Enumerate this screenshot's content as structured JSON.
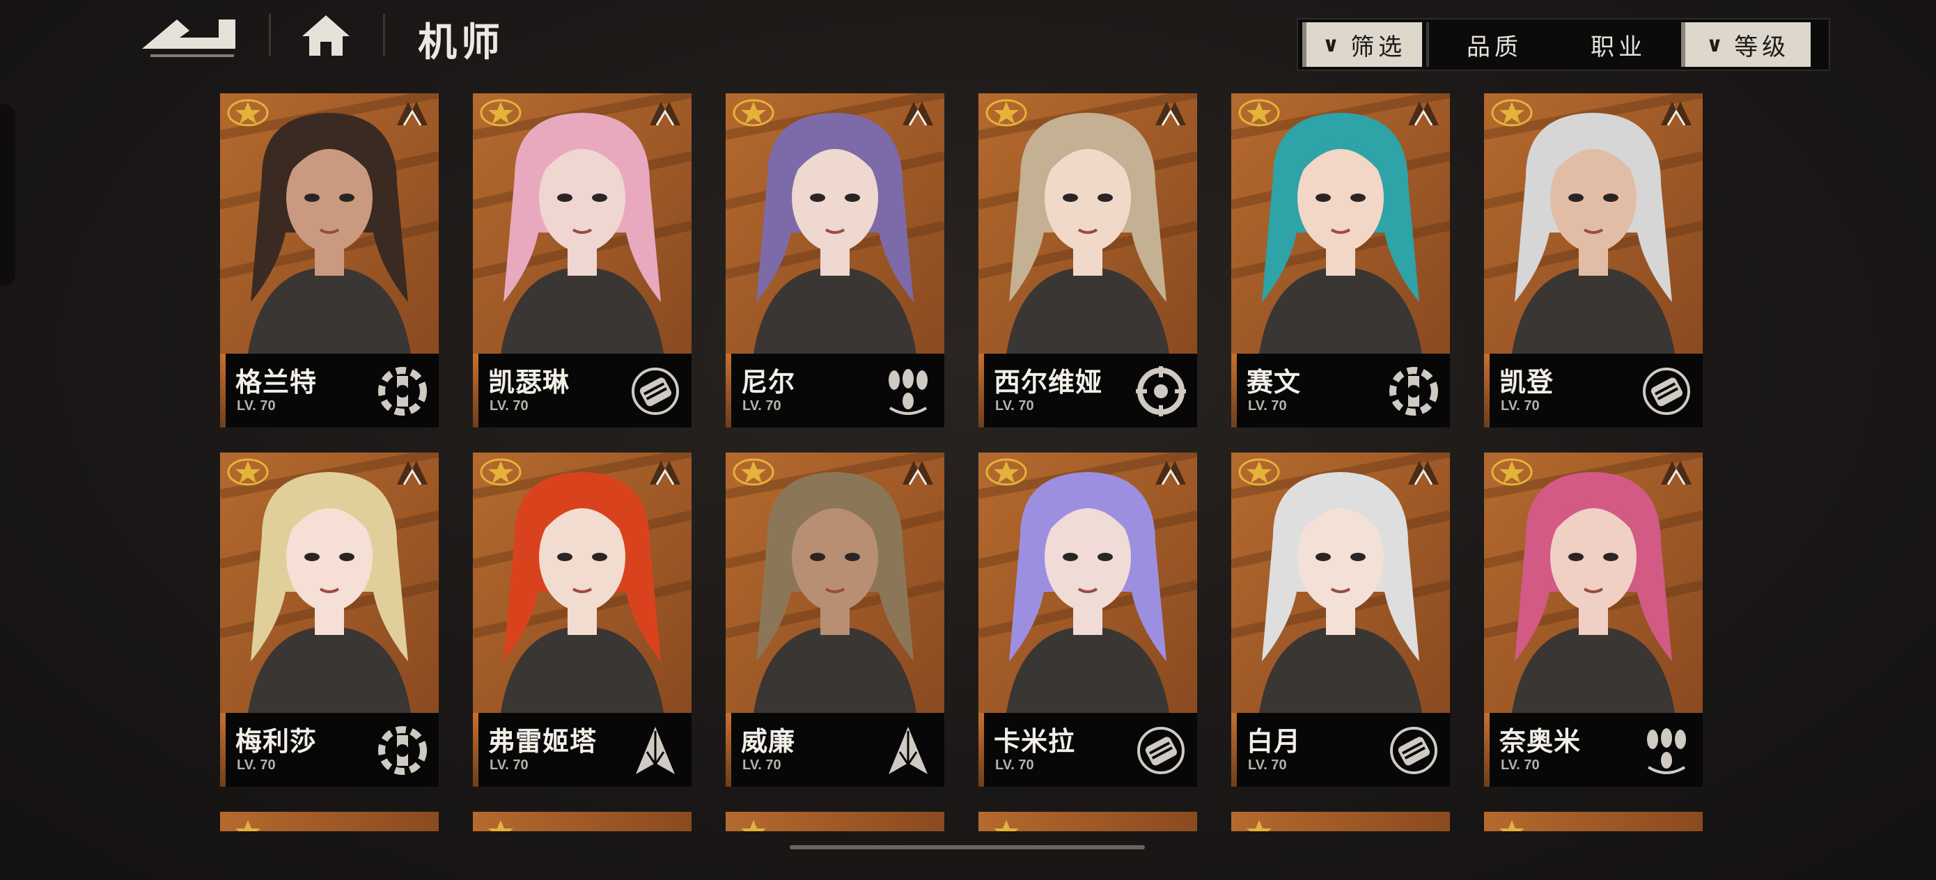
{
  "page": {
    "title": "机师"
  },
  "filters": [
    {
      "label": "筛选",
      "chevron": true,
      "style": "light"
    },
    {
      "label": "品质",
      "chevron": false,
      "style": "dark"
    },
    {
      "label": "职业",
      "chevron": false,
      "style": "dark"
    },
    {
      "label": "等级",
      "chevron": true,
      "style": "light"
    }
  ],
  "characters": [
    {
      "name": "格兰特",
      "level": "LV. 70",
      "role": "wrench",
      "hair": "#3a2a22",
      "skin": "#c99a80"
    },
    {
      "name": "凯瑟琳",
      "level": "LV. 70",
      "role": "fist",
      "hair": "#e8a9bf",
      "skin": "#efd6d0"
    },
    {
      "name": "尼尔",
      "level": "LV. 70",
      "role": "bombs",
      "hair": "#7d6aa8",
      "skin": "#eed8cf"
    },
    {
      "name": "西尔维娅",
      "level": "LV. 70",
      "role": "target",
      "hair": "#c4b092",
      "skin": "#f1d9c9"
    },
    {
      "name": "赛文",
      "level": "LV. 70",
      "role": "wrench",
      "hair": "#2ea3a8",
      "skin": "#f2d6c6"
    },
    {
      "name": "凯登",
      "level": "LV. 70",
      "role": "fist",
      "hair": "#d6d6d6",
      "skin": "#e2bda6"
    },
    {
      "name": "梅利莎",
      "level": "LV. 70",
      "role": "wrench",
      "hair": "#e0cf9a",
      "skin": "#f6dfd4"
    },
    {
      "name": "弗雷姬塔",
      "level": "LV. 70",
      "role": "arrow",
      "hair": "#d8431e",
      "skin": "#f2dbcf"
    },
    {
      "name": "威廉",
      "level": "LV. 70",
      "role": "arrow",
      "hair": "#8b7758",
      "skin": "#b88f72"
    },
    {
      "name": "卡米拉",
      "level": "LV. 70",
      "role": "fist",
      "hair": "#9d8fe0",
      "skin": "#f0dbd6"
    },
    {
      "name": "白月",
      "level": "LV. 70",
      "role": "fist",
      "hair": "#dedede",
      "skin": "#f3e0d6"
    },
    {
      "name": "奈奥米",
      "level": "LV. 70",
      "role": "bombs",
      "hair": "#d25a85",
      "skin": "#f0d0c4"
    }
  ],
  "colors": {
    "card_bg": "#8a4a20",
    "card_bg_light": "#b56a2e",
    "badge": "#e4b33a"
  }
}
